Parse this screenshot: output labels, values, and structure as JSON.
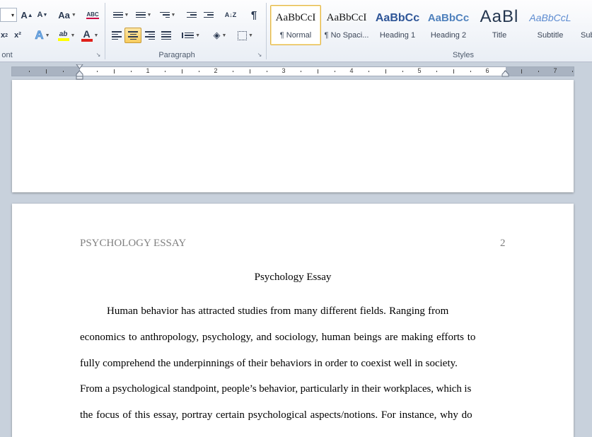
{
  "ribbon": {
    "font_group": {
      "label": "ont",
      "grow_font": "A",
      "shrink_font": "A",
      "change_case": "Aa",
      "clear_format": "ABC",
      "subscript": "x",
      "superscript": "x²",
      "text_effects": "A",
      "highlight": "ab",
      "font_color": "A",
      "highlight_color": "#ffff00",
      "font_color_value": "#e0201a"
    },
    "paragraph_group": {
      "label": "Paragraph",
      "sort_label": "A↓Z",
      "pilcrow": "¶"
    },
    "styles_group": {
      "label": "Styles",
      "items": [
        {
          "preview": "AaBbCcI",
          "name": "¶ Normal",
          "selected": true
        },
        {
          "preview": "AaBbCcI",
          "name": "¶ No Spaci..."
        },
        {
          "preview": "AaBbCc",
          "name": "Heading 1"
        },
        {
          "preview": "AaBbCc",
          "name": "Heading 2"
        },
        {
          "preview": "AaBl",
          "name": "Title"
        },
        {
          "preview": "AaBbCcL",
          "name": "Subtitle"
        },
        {
          "preview": "",
          "name": "Sub"
        }
      ]
    }
  },
  "ruler": {
    "numbers": [
      "1",
      "2",
      "3",
      "4",
      "5",
      "6",
      "7"
    ]
  },
  "document": {
    "header_left": "PSYCHOLOGY ESSAY",
    "page_number": "2",
    "title": "Psychology Essay",
    "lines": [
      "Human behavior has attracted studies from many different fields. Ranging from",
      "economics to anthropology, psychology, and sociology, human beings are making efforts to",
      "fully comprehend the underpinnings of their behaviors in order to coexist well in society.",
      "From a psychological standpoint, people’s behavior, particularly in their workplaces, which is",
      "the focus of this essay, portray certain psychological aspects/notions. For instance, why do"
    ]
  }
}
